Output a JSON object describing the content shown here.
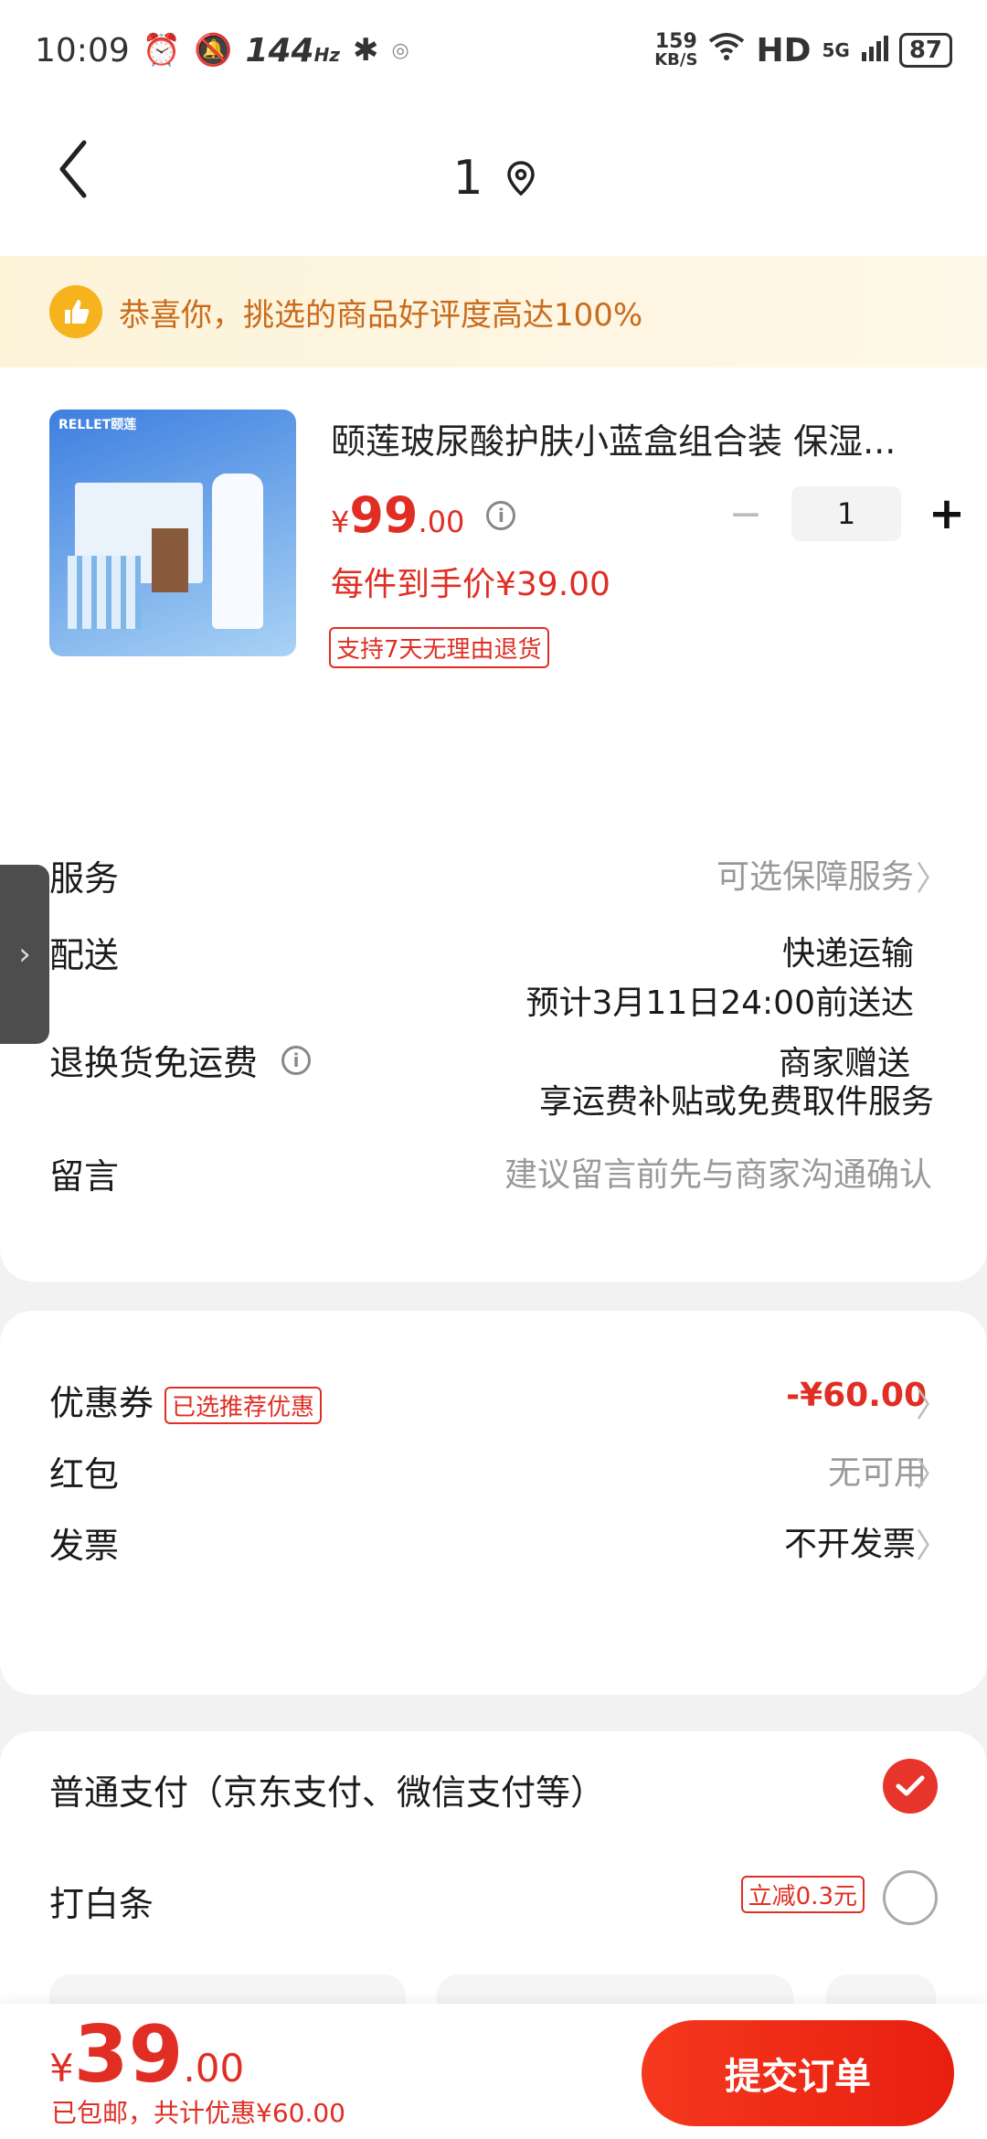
{
  "status_bar": {
    "time": "10:09",
    "refresh": "144",
    "refresh_unit": "Hz",
    "net_speed": "159",
    "net_unit": "KB/S",
    "hd": "HD",
    "signal": "5G",
    "battery": "87"
  },
  "nav": {
    "title": "1"
  },
  "banner": {
    "text": "恭喜你，挑选的商品好评度高达100%"
  },
  "product": {
    "title": "颐莲玻尿酸护肤小蓝盒组合装 保湿...",
    "image_brand": "RELLET颐莲",
    "price_currency": "¥",
    "price_int": "99",
    "price_dec": ".00",
    "final_price": "每件到手价¥39.00",
    "return_badge": "支持7天无理由退货",
    "quantity": "1",
    "minus": "−",
    "plus": "+"
  },
  "rows": {
    "service": {
      "label": "服务",
      "value": "可选保障服务"
    },
    "delivery": {
      "label": "配送",
      "value": "快递运输",
      "eta": "预计3月11日24:00前送达"
    },
    "return_freight": {
      "label": "退换货免运费",
      "value": "商家赠送",
      "sub": "享运费补贴或免费取件服务"
    },
    "message": {
      "label": "留言",
      "placeholder": "建议留言前先与商家沟通确认"
    }
  },
  "discounts": {
    "coupon": {
      "label": "优惠券",
      "tag": "已选推荐优惠",
      "value": "-¥60.00"
    },
    "red_packet": {
      "label": "红包",
      "value": "无可用"
    },
    "invoice": {
      "label": "发票",
      "value": "不开发票"
    }
  },
  "payment": {
    "normal": {
      "label": "普通支付（京东支付、微信支付等）",
      "selected": true
    },
    "baitiao": {
      "label": "打白条",
      "tag": "立减0.3元",
      "selected": false
    }
  },
  "footer": {
    "total_currency": "¥",
    "total_int": "39",
    "total_dec": ".00",
    "note": "已包邮，共计优惠¥60.00",
    "submit": "提交订单"
  },
  "colors": {
    "accent": "#e02e24",
    "banner_bg": "#fdf3d9",
    "banner_text": "#c86b1c"
  }
}
